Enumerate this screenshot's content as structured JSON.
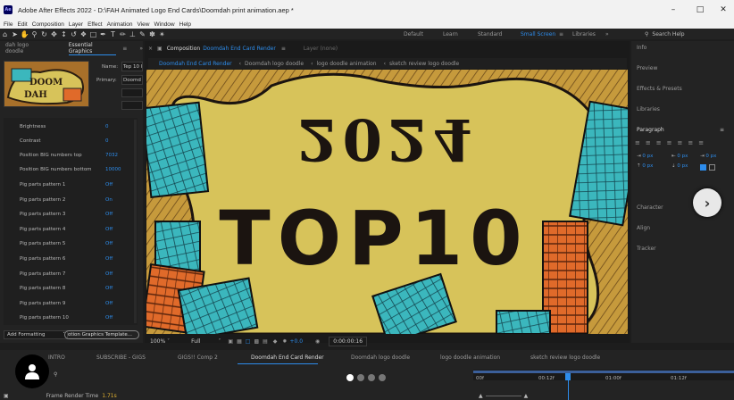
{
  "window": {
    "title": "Adobe After Effects 2022 - D:\\FAH Animated Logo End Cards\\Doomdah print animation.aep *",
    "app_icon": "Ae"
  },
  "menu": [
    "File",
    "Edit",
    "Composition",
    "Layer",
    "Effect",
    "Animation",
    "View",
    "Window",
    "Help"
  ],
  "workspaces": {
    "items": [
      "Default",
      "Learn",
      "Standard",
      "Small Screen",
      "Libraries"
    ],
    "active": "Small Screen"
  },
  "search_help": "Search Help",
  "essential_graphics": {
    "tab_left": "dah logo doodle",
    "tab_active": "Essential Graphics",
    "name_label": "Name:",
    "name_value": "Tep 10 l",
    "primary_label": "Primary:",
    "primary_value": "Doomd",
    "properties": [
      {
        "name": "Brightness",
        "value": "0"
      },
      {
        "name": "Contrast",
        "value": "0"
      },
      {
        "name": "Position BIG numbers top",
        "value": "7032"
      },
      {
        "name": "Position BIG numbers bottom",
        "value": "10000"
      },
      {
        "name": "Pig parts pattern 1",
        "value": "Off"
      },
      {
        "name": "Pig parts pattern 2",
        "value": "On"
      },
      {
        "name": "Pig parts pattern 3",
        "value": "Off"
      },
      {
        "name": "Pig parts pattern 4",
        "value": "Off"
      },
      {
        "name": "Pig parts pattern 5",
        "value": "Off"
      },
      {
        "name": "Pig parts pattern 6",
        "value": "Off"
      },
      {
        "name": "Pig parts pattern 7",
        "value": "Off"
      },
      {
        "name": "Pig parts pattern 8",
        "value": "Off"
      },
      {
        "name": "Pig parts pattern 9",
        "value": "Off"
      },
      {
        "name": "Pig parts pattern 10",
        "value": "Off"
      }
    ],
    "add_formatting": "Add Formatting",
    "export_template": "otion Graphics Template..."
  },
  "composition": {
    "panel_label": "Composition",
    "comp_name": "Doomdah End Card Render",
    "layer_tab": "Layer (none)",
    "breadcrumbs": [
      "Doomdah End Card Render",
      "Doomdah logo doodle",
      "logo doodle animation",
      "sketch review logo doodle"
    ],
    "canvas_text_top": "2024",
    "canvas_text_bottom": "TOP10",
    "zoom": "100%",
    "resolution": "Full",
    "exposure": "+0.0",
    "timecode": "0:00:00:16"
  },
  "right_panels": [
    "Info",
    "Preview",
    "Effects & Presets",
    "Libraries",
    "Paragraph",
    "Character",
    "Align",
    "Tracker"
  ],
  "paragraph": {
    "fields": [
      "0 px",
      "0 px",
      "0 px",
      "0 px",
      "0 px"
    ]
  },
  "timeline": {
    "tabs": [
      "INTRO",
      "SUBSCRIBE - GIGS",
      "GIGS!! Comp 2",
      "Doomdah End Card Render",
      "Doomdah logo doodle",
      "logo doodle animation",
      "sketch review logo doodle"
    ],
    "active_tab": "Doomdah End Card Render",
    "frame_render_label": "Frame Render Time",
    "frame_render_value": "1.71s",
    "ruler": [
      "00f",
      "00:12f",
      "01:00f",
      "01:12f"
    ]
  },
  "colors": {
    "accent": "#2d8ceb",
    "canvas_yellow": "#d7c35a",
    "teal": "#3bb7bd",
    "orange": "#e06a2a"
  }
}
